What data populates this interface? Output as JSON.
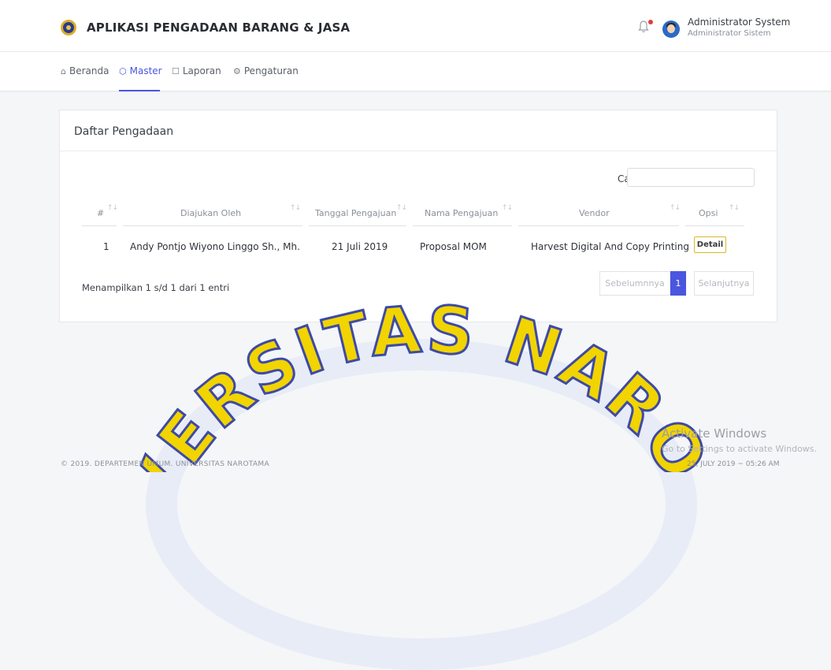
{
  "header": {
    "app_title": "APLIKASI PENGADAAN BARANG & JASA",
    "user_name": "Administrator System",
    "user_role": "Administrator Sistem"
  },
  "nav": {
    "items": [
      {
        "label": "Beranda",
        "icon": "home-icon"
      },
      {
        "label": "Master",
        "icon": "cube-icon",
        "active": true
      },
      {
        "label": "Laporan",
        "icon": "document-icon"
      },
      {
        "label": "Pengaturan",
        "icon": "gear-icon"
      }
    ]
  },
  "card": {
    "title": "Daftar Pengadaan",
    "search_label": "Cari",
    "search_value": "",
    "columns": [
      "#",
      "Diajukan Oleh",
      "Tanggal Pengajuan",
      "Nama Pengajuan",
      "Vendor",
      "Opsi"
    ],
    "rows": [
      {
        "no": "1",
        "submitted_by": "Andy Pontjo Wiyono Linggo Sh., Mh.",
        "date": "21 Juli 2019",
        "name": "Proposal MOM",
        "vendor": "Harvest Digital And Copy Printing",
        "action": "Detail"
      }
    ],
    "info": "Menampilkan 1 s/d 1 dari 1 entri",
    "pagination": {
      "prev": "Sebelumnnya",
      "current": "1",
      "next": "Selanjutnya"
    }
  },
  "watermark_text": "VERSITAS NARO",
  "footer": {
    "left": "© 2019. DEPARTEMEN UMUM. UNIVERSITAS NAROTAMA",
    "right": "25, JULY 2019 ~ 05:26 AM"
  },
  "os_overlay": {
    "title": "Activate Windows",
    "subtitle": "Go to Settings to activate Windows."
  },
  "colors": {
    "accent": "#4a56e0",
    "detail_border": "#d8b82a",
    "notification": "#e23c3c"
  }
}
